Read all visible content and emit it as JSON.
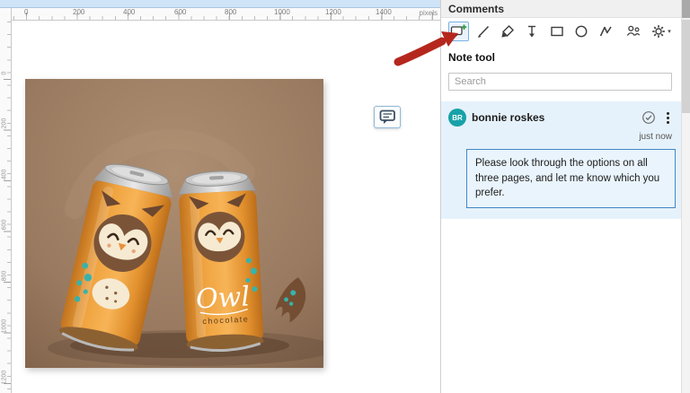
{
  "ruler": {
    "unit_label": "pixels",
    "h_ticks": [
      "0",
      "200",
      "400",
      "600",
      "800",
      "1000",
      "1200",
      "1400"
    ],
    "v_ticks": [
      "0",
      "200",
      "400",
      "600",
      "800",
      "1000",
      "1200"
    ]
  },
  "artwork": {
    "brand_script": "Owl",
    "brand_sub": "chocolate"
  },
  "comments_panel": {
    "title": "Comments",
    "tool_label": "Note tool",
    "search_placeholder": "Search",
    "tool_icons": [
      "note-tool-icon",
      "freehand-tool-icon",
      "highlighter-tool-icon",
      "arrow-tool-icon",
      "rectangle-tool-icon",
      "ellipse-tool-icon",
      "polyline-tool-icon",
      "share-icon",
      "settings-gear-icon"
    ]
  },
  "comment": {
    "avatar_initials": "BR",
    "author": "bonnie roskes",
    "timestamp": "just now",
    "body": "Please look through the options on all three pages, and let me know which you prefer."
  },
  "colors": {
    "comment_accent": "#3f87c9",
    "comment_card_bg": "#e6f2fb",
    "avatar_teal": "#17a2a8",
    "annotation_arrow_red": "#b5271d",
    "note_plus_green": "#2e9e3e"
  }
}
